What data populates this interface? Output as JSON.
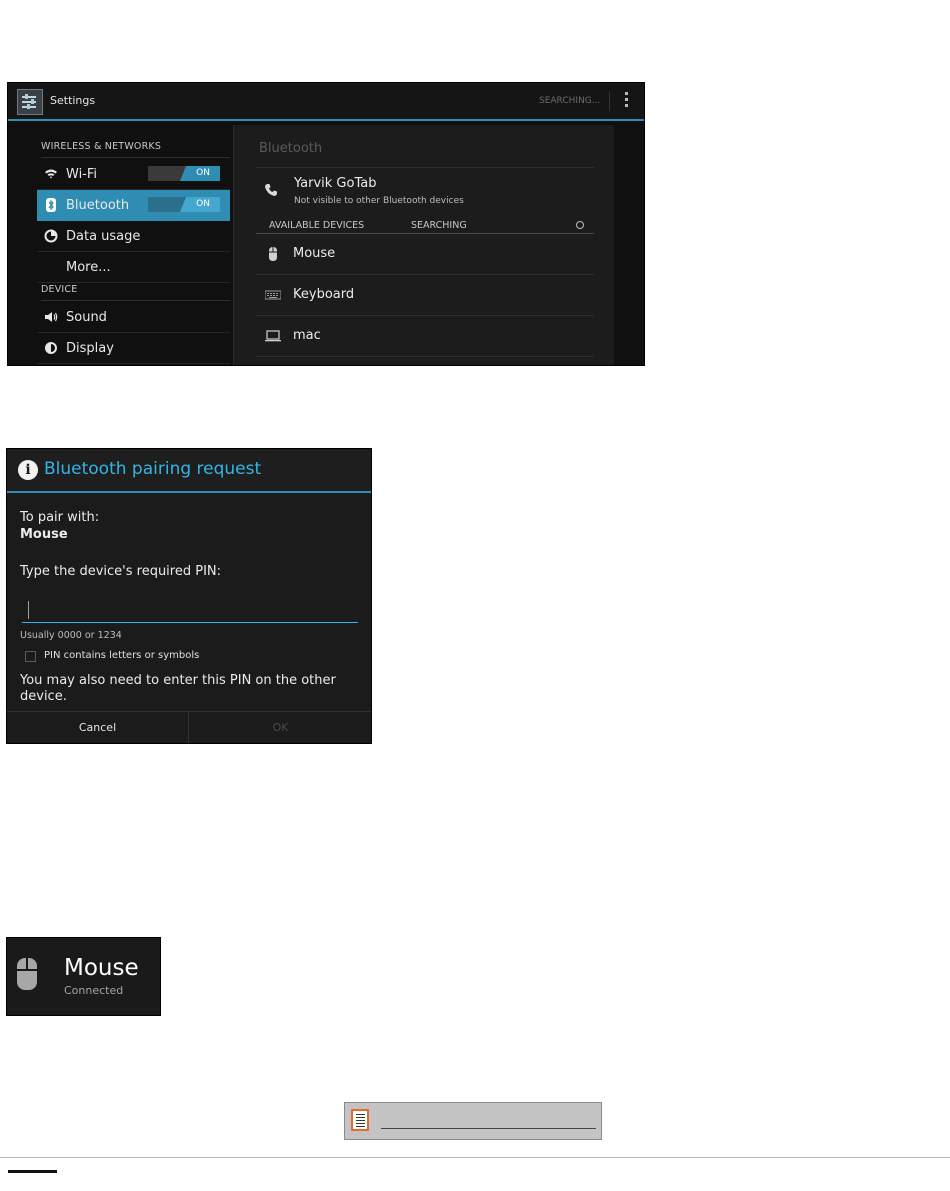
{
  "settings": {
    "app_title": "Settings",
    "status": "SEARCHING...",
    "sections": {
      "wireless": "WIRELESS & NETWORKS",
      "device": "DEVICE"
    },
    "menu": {
      "wifi": {
        "label": "Wi-Fi",
        "toggle": "ON",
        "icon": "wifi-icon"
      },
      "bluetooth": {
        "label": "Bluetooth",
        "toggle": "ON",
        "icon": "bluetooth-icon",
        "selected": true
      },
      "data_usage": {
        "label": "Data usage",
        "icon": "data-usage-icon"
      },
      "more": {
        "label": "More..."
      },
      "sound": {
        "label": "Sound",
        "icon": "speaker-icon"
      },
      "display": {
        "label": "Display",
        "icon": "display-brightness-icon"
      }
    },
    "detail": {
      "title": "Bluetooth",
      "this_device": {
        "name": "Yarvik GoTab",
        "visibility": "Not visible to other Bluetooth devices"
      },
      "available_header": "AVAILABLE DEVICES",
      "searching_label": "SEARCHING",
      "devices": [
        {
          "name": "Mouse",
          "icon": "mouse-icon"
        },
        {
          "name": "Keyboard",
          "icon": "keyboard-icon"
        },
        {
          "name": "mac",
          "icon": "laptop-icon"
        }
      ]
    }
  },
  "pairing_dialog": {
    "title": "Bluetooth pairing request",
    "pair_with_label": "To pair with:",
    "device_name": "Mouse",
    "pin_prompt": "Type the device's required PIN:",
    "pin_value": "",
    "pin_hint": "Usually 0000 or 1234",
    "checkbox_label": "PIN contains letters or symbols",
    "checkbox_checked": false,
    "note": "You may also need to enter this PIN on the other device.",
    "cancel_label": "Cancel",
    "ok_label": "OK"
  },
  "connected_card": {
    "device_name": "Mouse",
    "status": "Connected"
  },
  "colors": {
    "accent": "#33b5e5",
    "selected_row": "#2f8cb3",
    "panel_bg": "#101010"
  }
}
